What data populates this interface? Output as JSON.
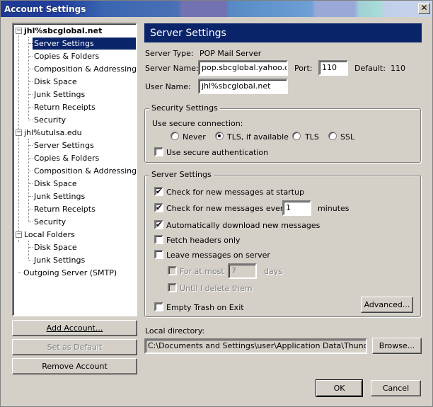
{
  "window": {
    "title": "Account Settings",
    "close_glyph": "✕"
  },
  "tree": {
    "accounts": [
      {
        "name": "jhl%sbcglobal.net",
        "expander": "−",
        "children": [
          "Server Settings",
          "Copies & Folders",
          "Composition & Addressing",
          "Disk Space",
          "Junk Settings",
          "Return Receipts",
          "Security"
        ]
      },
      {
        "name": "jhl%utulsa.edu",
        "expander": "−",
        "children": [
          "Server Settings",
          "Copies & Folders",
          "Composition & Addressing",
          "Disk Space",
          "Junk Settings",
          "Return Receipts",
          "Security"
        ]
      },
      {
        "name": "Local Folders",
        "expander": "−",
        "children": [
          "Disk Space",
          "Junk Settings"
        ]
      }
    ],
    "outgoing": "Outgoing Server (SMTP)"
  },
  "left_buttons": {
    "add": "Add Account...",
    "set_default": "Set as Default",
    "remove": "Remove Account"
  },
  "panel": {
    "title": "Server Settings",
    "server_type_label": "Server Type:",
    "server_type_value": "POP Mail Server",
    "server_name_label": "Server Name:",
    "server_name_value": "pop.sbcglobal.yahoo.com",
    "port_label": "Port:",
    "port_value": "110",
    "default_label": "Default:",
    "default_value": "110",
    "user_name_label": "User Name:",
    "user_name_value": "jhl%sbcglobal.net"
  },
  "security": {
    "legend": "Security Settings",
    "use_secure_label": "Use secure connection:",
    "options": [
      "Never",
      "TLS, if available",
      "TLS",
      "SSL"
    ],
    "selected": "TLS, if available",
    "secure_auth_label": "Use secure authentication",
    "secure_auth_checked": false
  },
  "server_settings": {
    "legend": "Server Settings",
    "check_startup": "Check for new messages at startup",
    "check_every": "Check for new messages every",
    "check_every_value": "1",
    "minutes": "minutes",
    "auto_download": "Automatically download new messages",
    "fetch_headers": "Fetch headers only",
    "leave_on_server": "Leave messages on server",
    "for_at_most": "For at most",
    "days_value": "7",
    "days": "days",
    "until_delete": "Until I delete them",
    "empty_trash": "Empty Trash on Exit",
    "advanced": "Advanced...",
    "check_mark": "✔"
  },
  "local_dir": {
    "label": "Local directory:",
    "value": "C:\\Documents and Settings\\user\\Application Data\\Thunderbird\\",
    "browse": "Browse..."
  },
  "footer": {
    "ok": "OK",
    "cancel": "Cancel"
  }
}
